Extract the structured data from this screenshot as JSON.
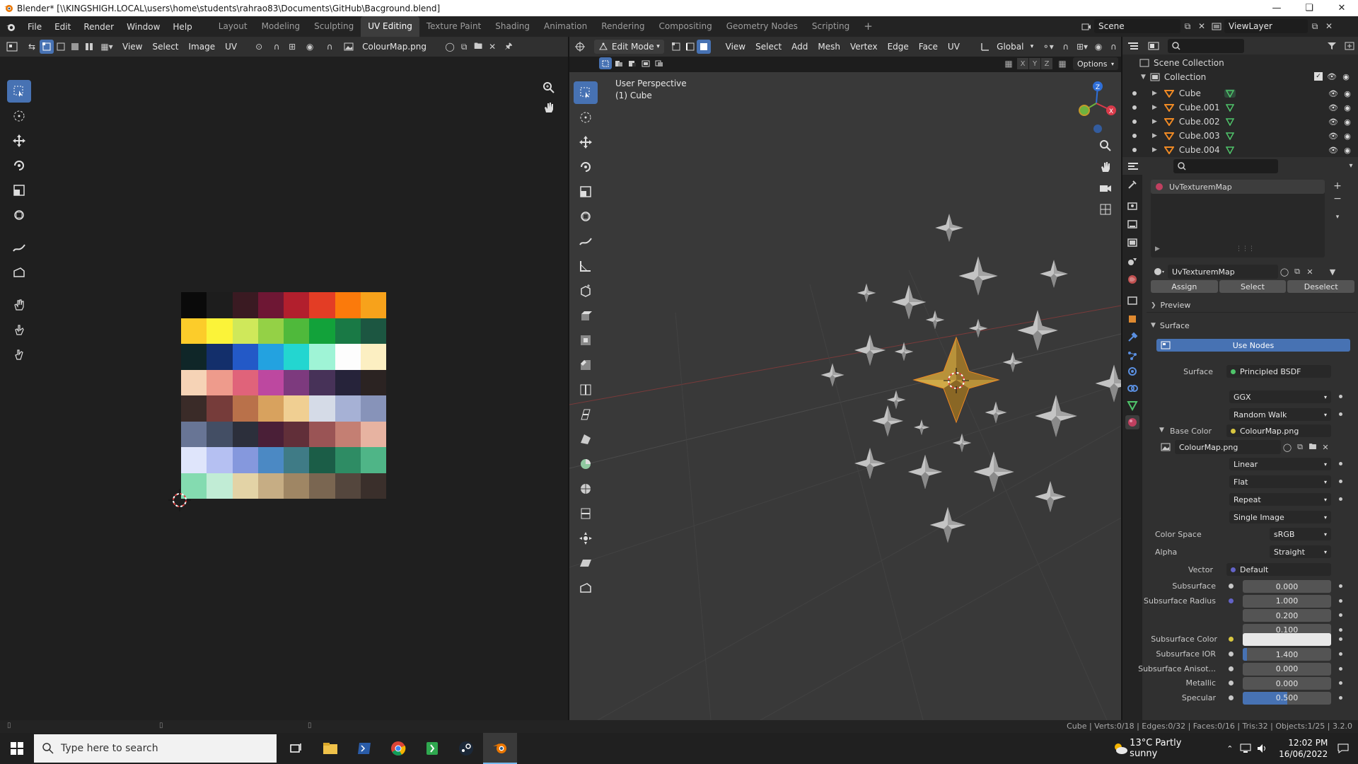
{
  "titlebar": {
    "title": "Blender* [\\\\KINGSHIGH.LOCAL\\users\\home\\students\\rahrao83\\Documents\\GitHub\\Bacground.blend]"
  },
  "menus": [
    "File",
    "Edit",
    "Render",
    "Window",
    "Help"
  ],
  "workspaces": [
    "Layout",
    "Modeling",
    "Sculpting",
    "UV Editing",
    "Texture Paint",
    "Shading",
    "Animation",
    "Rendering",
    "Compositing",
    "Geometry Nodes",
    "Scripting"
  ],
  "active_workspace": "UV Editing",
  "scene": {
    "scene_name": "Scene",
    "view_layer": "ViewLayer"
  },
  "uv_editor": {
    "menus": [
      "View",
      "Select",
      "Image",
      "UV"
    ],
    "image_name": "ColourMap.png",
    "palette": [
      [
        "#0a0a0a",
        "#1d1d1d",
        "#3a1a22",
        "#6e1734",
        "#b21f2d",
        "#e33d25",
        "#fb7a0b",
        "#f7a21b"
      ],
      [
        "#fccc2a",
        "#fbf339",
        "#cfe85a",
        "#94d146",
        "#4fb93b",
        "#12a23a",
        "#197945",
        "#1c5641"
      ],
      [
        "#0f2628",
        "#132f6b",
        "#2359c7",
        "#23a2e0",
        "#23d6d0",
        "#9ff4d6",
        "#fdfdfd",
        "#fcefc2"
      ],
      [
        "#f6d3b6",
        "#ee9b8c",
        "#e0637a",
        "#bd48a0",
        "#7d3a7e",
        "#473258",
        "#26233a",
        "#2b2322"
      ],
      [
        "#3a2b28",
        "#763c3a",
        "#b9714a",
        "#d8a25e",
        "#f0cf92",
        "#d5dbe7",
        "#a6b1d5",
        "#8793b9"
      ],
      [
        "#687595",
        "#434e64",
        "#2c2f3b",
        "#4a1f37",
        "#612f39",
        "#9a5455",
        "#c47f73",
        "#e7b3a1"
      ],
      [
        "#dfe5fb",
        "#b5c0f2",
        "#8598dd",
        "#4b89c4",
        "#3f7b86",
        "#1b5d47",
        "#2e8c64",
        "#4fb587"
      ],
      [
        "#84dbb0",
        "#c1ecd5",
        "#e3d3a6",
        "#c6ad84",
        "#9f8664",
        "#7a6651",
        "#54463d",
        "#3a2f2b"
      ]
    ]
  },
  "viewport": {
    "mode": "Edit Mode",
    "menus": [
      "View",
      "Select",
      "Add",
      "Mesh",
      "Vertex",
      "Edge",
      "Face",
      "UV"
    ],
    "transform_orientation": "Global",
    "options_label": "Options",
    "overlay_line1": "User Perspective",
    "overlay_line2": "(1) Cube",
    "axes": [
      "X",
      "Y",
      "Z"
    ]
  },
  "outliner": {
    "root": "Scene Collection",
    "collection": "Collection",
    "objects": [
      "Cube",
      "Cube.001",
      "Cube.002",
      "Cube.003",
      "Cube.004"
    ]
  },
  "properties": {
    "material_slot": "UvTexturemMap",
    "material_name": "UvTexturemMap",
    "buttons": [
      "Assign",
      "Select",
      "Deselect"
    ],
    "preview_label": "Preview",
    "surface_panel": "Surface",
    "use_nodes": "Use Nodes",
    "surface_label": "Surface",
    "surface_value": "Principled BSDF",
    "distribution": "GGX",
    "subsurface_method": "Random Walk",
    "base_color_label": "Base Color",
    "base_color_value": "ColourMap.png",
    "image_name": "ColourMap.png",
    "interpolation": "Linear",
    "projection": "Flat",
    "extension": "Repeat",
    "source": "Single Image",
    "color_space_label": "Color Space",
    "color_space": "sRGB",
    "alpha_label": "Alpha",
    "alpha": "Straight",
    "vector_label": "Vector",
    "vector_value": "Default",
    "fields": [
      {
        "label": "Subsurface",
        "value": "0.000"
      },
      {
        "label": "Subsurface Radius",
        "value": "1.000"
      },
      {
        "label": "",
        "value": "0.200"
      },
      {
        "label": "",
        "value": "0.100"
      }
    ],
    "subsurface_color_label": "Subsurface Color",
    "subsurface_color": "#e8e8e8",
    "fields2": [
      {
        "label": "Subsurface IOR",
        "value": "1.400",
        "fill": 0.05
      },
      {
        "label": "Subsurface Anisot...",
        "value": "0.000",
        "fill": 0
      },
      {
        "label": "Metallic",
        "value": "0.000",
        "fill": 0
      },
      {
        "label": "Specular",
        "value": "0.500",
        "fill": 0.5
      }
    ]
  },
  "statusbar": {
    "stats": "Cube | Verts:0/18 | Edges:0/32 | Faces:0/16 | Tris:32 | Objects:1/25 | 3.2.0"
  },
  "taskbar": {
    "search_placeholder": "Type here to search",
    "weather": "13°C  Partly sunny",
    "time": "12:02 PM",
    "date": "16/06/2022"
  },
  "colors": {
    "accent": "#4772b3",
    "vertex_orange": "#f08a24",
    "mesh_gold": "#b8923a"
  }
}
